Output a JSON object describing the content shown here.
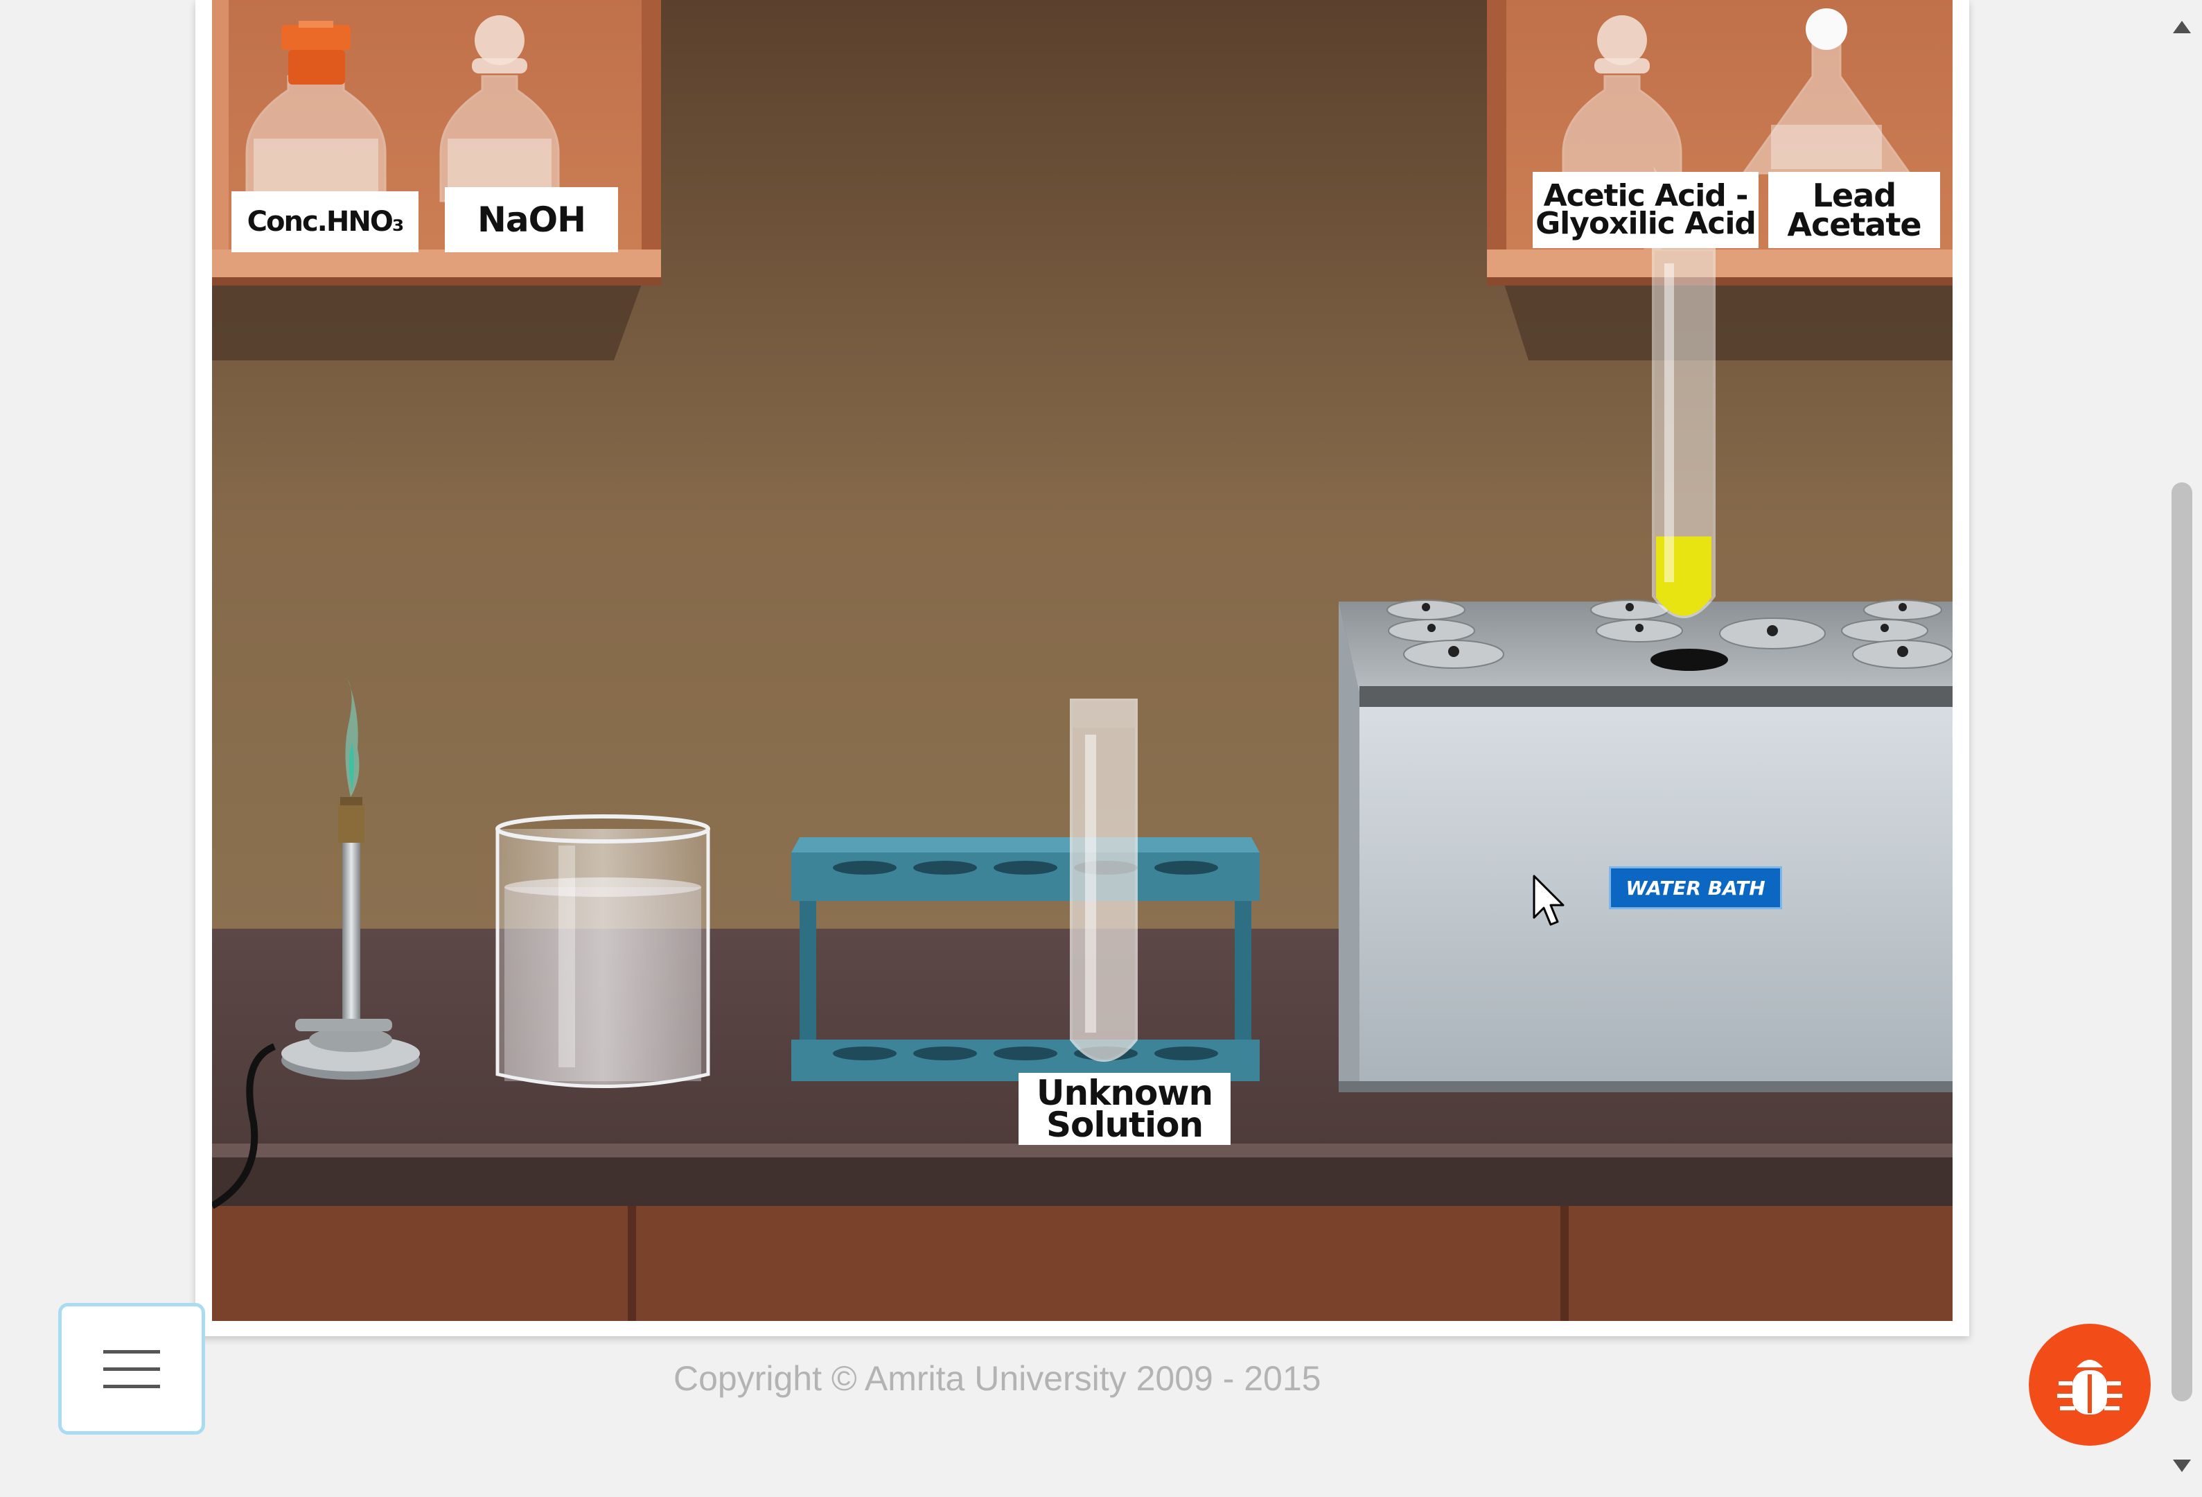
{
  "shelf_left": {
    "bottles": [
      {
        "label": "Conc.HNO₃"
      },
      {
        "label": "NaOH"
      }
    ]
  },
  "shelf_right": {
    "bottles": [
      {
        "label_line1": "Acetic Acid -",
        "label_line2": "Glyoxilic Acid"
      },
      {
        "label_line1": "Lead",
        "label_line2": "Acetate"
      }
    ]
  },
  "bench": {
    "test_tube_rack": {
      "label_line1": "Unknown",
      "label_line2": "Solution"
    },
    "water_bath": {
      "label": "WATER BATH"
    }
  },
  "footer": {
    "copyright": "Copyright © Amrita University 2009 - 2015"
  },
  "controls": {
    "menu_icon": "hamburger-menu-icon",
    "bug_icon": "bug-icon"
  },
  "colors": {
    "wall": "#7a5f44",
    "bench_top": "#5e4a46",
    "cabinet": "#7a412b",
    "water_bath_label_bg": "#0b67c2",
    "bug_button": "#f24d18",
    "yellow_solution": "#e8e411"
  }
}
